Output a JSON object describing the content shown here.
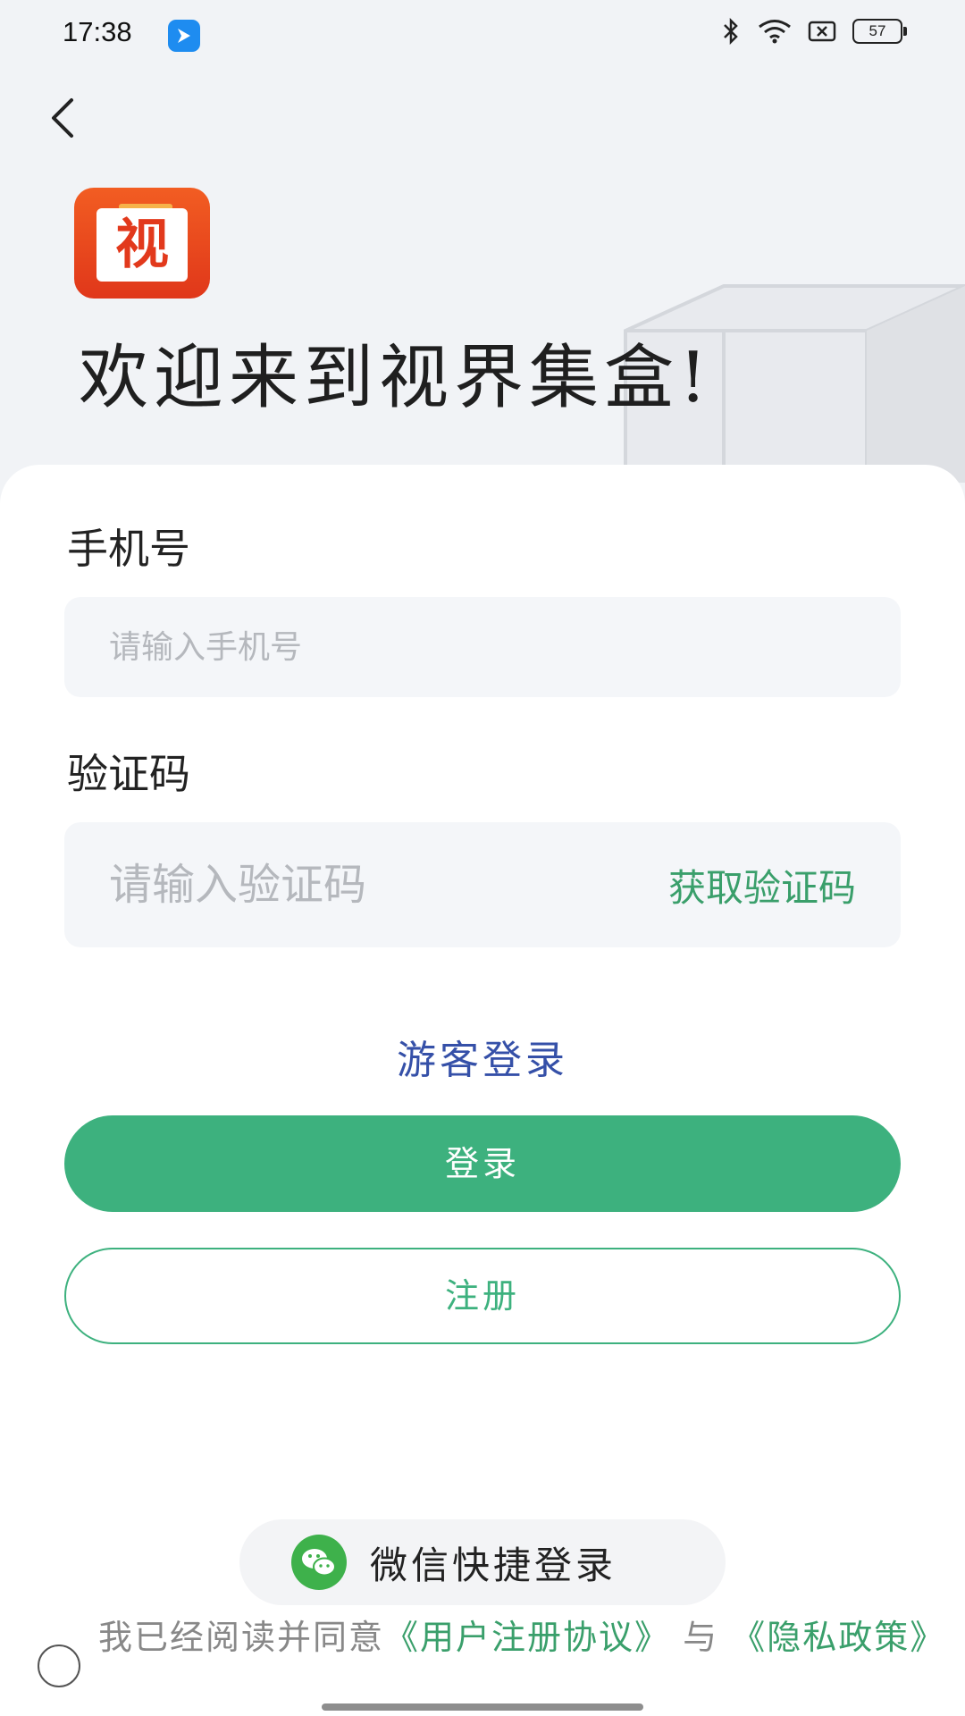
{
  "status_bar": {
    "time": "17:38",
    "battery": "57"
  },
  "header": {
    "welcome": "欢迎来到视界集盒!",
    "logo_char": "视"
  },
  "form": {
    "phone_label": "手机号",
    "phone_placeholder": "请输入手机号",
    "code_label": "验证码",
    "code_placeholder": "请输入验证码",
    "get_code": "获取验证码"
  },
  "actions": {
    "guest_login": "游客登录",
    "login": "登录",
    "register": "注册",
    "wechat_login": "微信快捷登录"
  },
  "agreement": {
    "prefix": "我已经阅读并同意",
    "user_agreement": "《用户注册协议》",
    "and": " 与 ",
    "privacy_policy": "《隐私政策》"
  },
  "colors": {
    "accent": "#3db17e",
    "guest_link": "#3550a8",
    "logo": "#e2391c"
  }
}
